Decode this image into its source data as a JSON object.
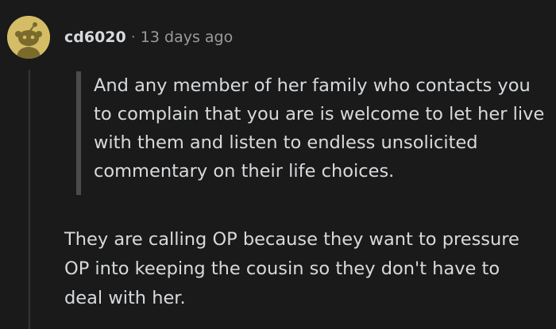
{
  "comment": {
    "username": "cd6020",
    "separator": "·",
    "timestamp": "13 days ago",
    "quote": "And any member of her family who contacts you to complain that you are is welcome to let her live with them and listen to endless unsolicited commentary on their life choices.",
    "body": "They are calling OP because they want to pressure OP into keeping the cousin so they don't have to deal with her."
  },
  "colors": {
    "background": "#1a1a1b",
    "avatar_bg": "#d4bd66",
    "text": "#d7dadc",
    "muted": "#9a9b9c",
    "quote_bar": "#4a4b4c"
  },
  "icons": {
    "avatar": "snoo-avatar-icon"
  }
}
